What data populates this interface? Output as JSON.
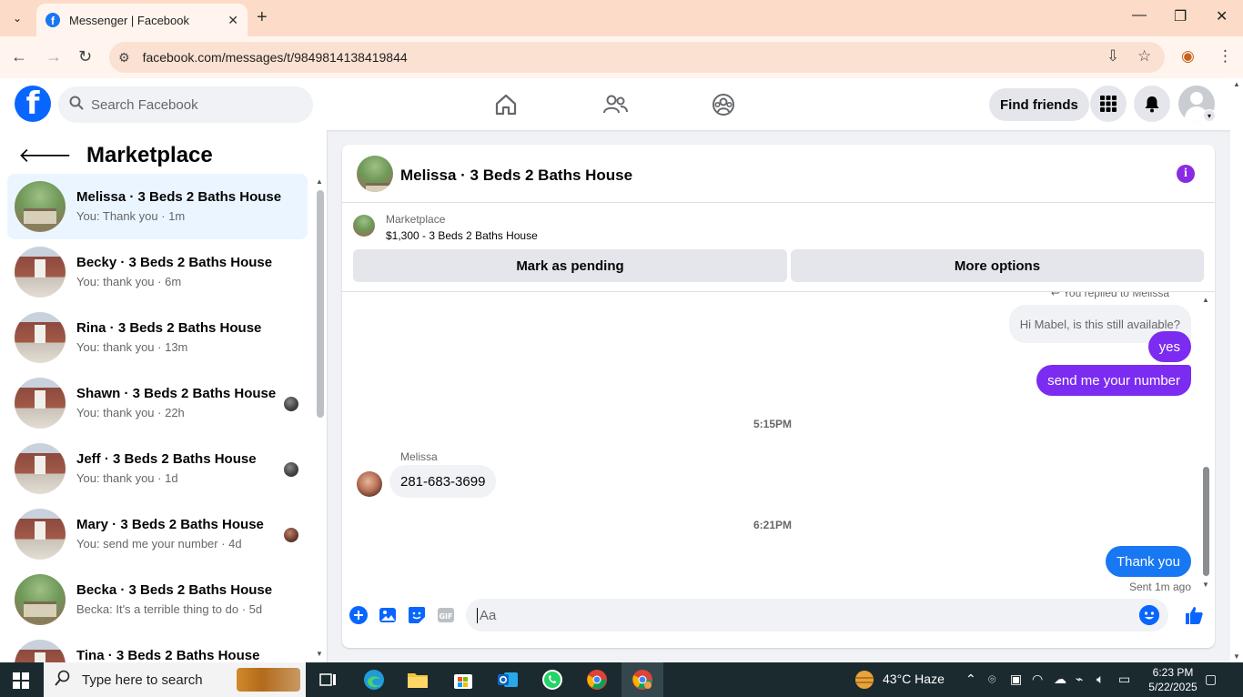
{
  "browser": {
    "tab_title": "Messenger | Facebook",
    "url": "facebook.com/messages/t/9849814138419844"
  },
  "fb_header": {
    "search_placeholder": "Search Facebook",
    "find_friends_label": "Find friends",
    "brand_color": "#0866ff"
  },
  "sidebar": {
    "title": "Marketplace",
    "conversations": [
      {
        "name": "Melissa · 3 Beds 2 Baths House",
        "preview": "You: Thank you · 1m",
        "thumb": "house-green",
        "active": true
      },
      {
        "name": "Becky · 3 Beds 2 Baths House",
        "preview": "You: thank you · 6m",
        "thumb": "house-brick"
      },
      {
        "name": "Rina · 3 Beds 2 Baths House",
        "preview": "You: thank you · 13m",
        "thumb": "house-brick"
      },
      {
        "name": "Shawn · 3 Beds 2 Baths House",
        "preview": "You: thank you · 22h",
        "thumb": "house-brick",
        "seen": true
      },
      {
        "name": "Jeff · 3 Beds 2 Baths House",
        "preview": "You: thank you · 1d",
        "thumb": "house-brick",
        "seen": true
      },
      {
        "name": "Mary · 3 Beds 2 Baths House",
        "preview": "You: send me your number · 4d",
        "thumb": "house-brick",
        "seen": true
      },
      {
        "name": "Becka · 3 Beds 2 Baths House",
        "preview": "Becka: It's a terrible thing to do · 5d",
        "thumb": "house-green"
      },
      {
        "name": "Tina · 3 Beds 2 Baths House",
        "preview": "",
        "thumb": "house-brick"
      }
    ]
  },
  "chat": {
    "title": "Melissa · 3 Beds 2 Baths House",
    "listing": {
      "label": "Marketplace",
      "price_title": "$1,300 - 3 Beds 2 Baths House"
    },
    "mark_pending_label": "Mark as pending",
    "more_options_label": "More options",
    "replied_to": "You replied to Melissa",
    "quoted_message": "Hi Mabel, is this still available?",
    "messages_out_1": [
      "yes",
      "send me your number"
    ],
    "timestamp_1": "5:15PM",
    "sender_name": "Melissa",
    "incoming_message": "281-683-3699",
    "timestamp_2": "6:21PM",
    "last_message": "Thank you",
    "sent_status": "Sent 1m ago",
    "composer_placeholder": "Aa",
    "outgoing_color": "#7b2cf0",
    "accent_blue": "#1877f2"
  },
  "taskbar": {
    "search_text": "Type here to search",
    "weather": "43°C  Haze",
    "time": "6:23 PM",
    "date": "5/22/2025"
  }
}
